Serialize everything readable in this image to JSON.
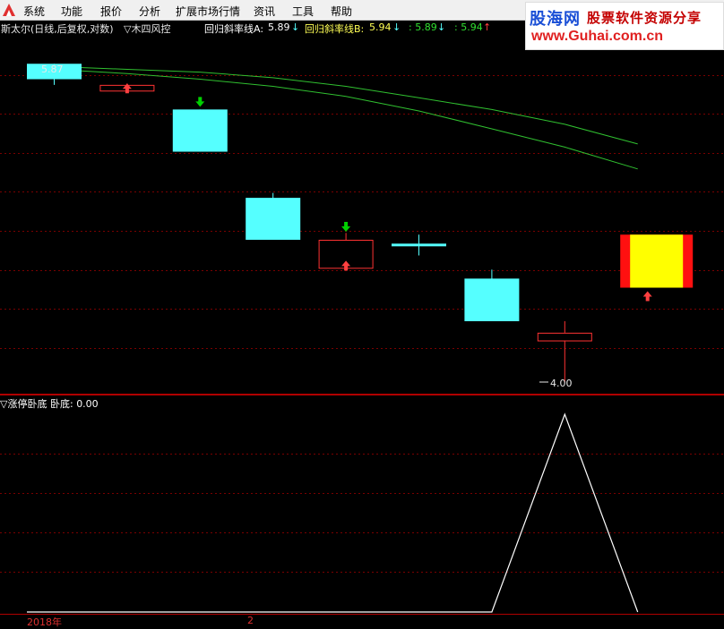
{
  "menu": {
    "items": [
      "系统",
      "功能",
      "报价",
      "分析",
      "扩展市场行情",
      "资讯",
      "工具",
      "帮助"
    ]
  },
  "logo": {
    "name": "股海网",
    "slogan": "股票软件资源分享",
    "url": "www.Guhai.com.cn"
  },
  "main_header": {
    "stock_title": "斯太尔(日线,后复权,对数)",
    "indicator_name": "▽木四风控",
    "line_a_label": "回归斜率线A:",
    "line_a_value": "5.89",
    "line_a_arrow": "↓",
    "line_b_label": "回归斜率线B:",
    "line_b_value": "5.94",
    "line_b_arrow": "↓",
    "extra_1": ": 5.89",
    "extra_1_arrow": "↓",
    "extra_2": ": 5.94",
    "extra_2_arrow": "↑"
  },
  "price_labels": {
    "top": "5.87",
    "low": "4.00"
  },
  "sub_header": {
    "indicator_name": "▽涨停卧底",
    "value_label": "卧底:",
    "value": "0.00"
  },
  "date_axis": {
    "year": "2018年",
    "month": "2"
  },
  "colors": {
    "down_candle": "#55ffff",
    "up_candle_border": "#ff3333",
    "highlight_body": "#ffff00",
    "highlight_side": "#ff1010",
    "regression_line": "#30c030",
    "grid": "#7a0000",
    "signal_line": "#ffffff",
    "buy_arrow": "#ff4040",
    "sell_arrow": "#00d000"
  },
  "chart_data": [
    {
      "type": "candlestick",
      "title": "斯太尔(日线,后复权,对数)",
      "candles": [
        {
          "open": 5.9,
          "close": 5.79,
          "high": 5.9,
          "low": 5.75,
          "direction": "down"
        },
        {
          "open": 5.71,
          "close": 5.75,
          "high": 5.76,
          "low": 5.71,
          "direction": "up",
          "signal": "buy"
        },
        {
          "open": 5.58,
          "close": 5.3,
          "high": 5.58,
          "low": 5.3,
          "direction": "down",
          "signal": "sell"
        },
        {
          "open": 5.01,
          "close": 4.76,
          "high": 5.04,
          "low": 4.76,
          "direction": "down"
        },
        {
          "open": 4.6,
          "close": 4.76,
          "high": 4.8,
          "low": 4.6,
          "direction": "up",
          "signal": "both"
        },
        {
          "open": 4.73,
          "close": 4.72,
          "high": 4.79,
          "low": 4.67,
          "direction": "doji"
        },
        {
          "open": 4.54,
          "close": 4.31,
          "high": 4.59,
          "low": 4.31,
          "direction": "down"
        },
        {
          "open": 4.21,
          "close": 4.25,
          "high": 4.31,
          "low": 4.0,
          "direction": "up"
        },
        {
          "open": 4.49,
          "close": 4.79,
          "high": 4.79,
          "low": 4.49,
          "direction": "up",
          "highlight": true,
          "signal": "buy"
        }
      ],
      "series": [
        {
          "name": "回归斜率线A",
          "values": [
            5.88,
            5.86,
            5.84,
            5.8,
            5.74,
            5.66,
            5.58,
            5.48,
            5.35
          ]
        },
        {
          "name": "回归斜率线B",
          "values": [
            5.86,
            5.83,
            5.79,
            5.74,
            5.67,
            5.57,
            5.45,
            5.33,
            5.19
          ]
        }
      ],
      "annotations": [
        "5.87",
        "4.00"
      ]
    },
    {
      "type": "line",
      "title": "涨停卧底",
      "series": [
        {
          "name": "卧底",
          "values": [
            0,
            0,
            0,
            0,
            0,
            0,
            0,
            1,
            0
          ]
        }
      ]
    }
  ]
}
